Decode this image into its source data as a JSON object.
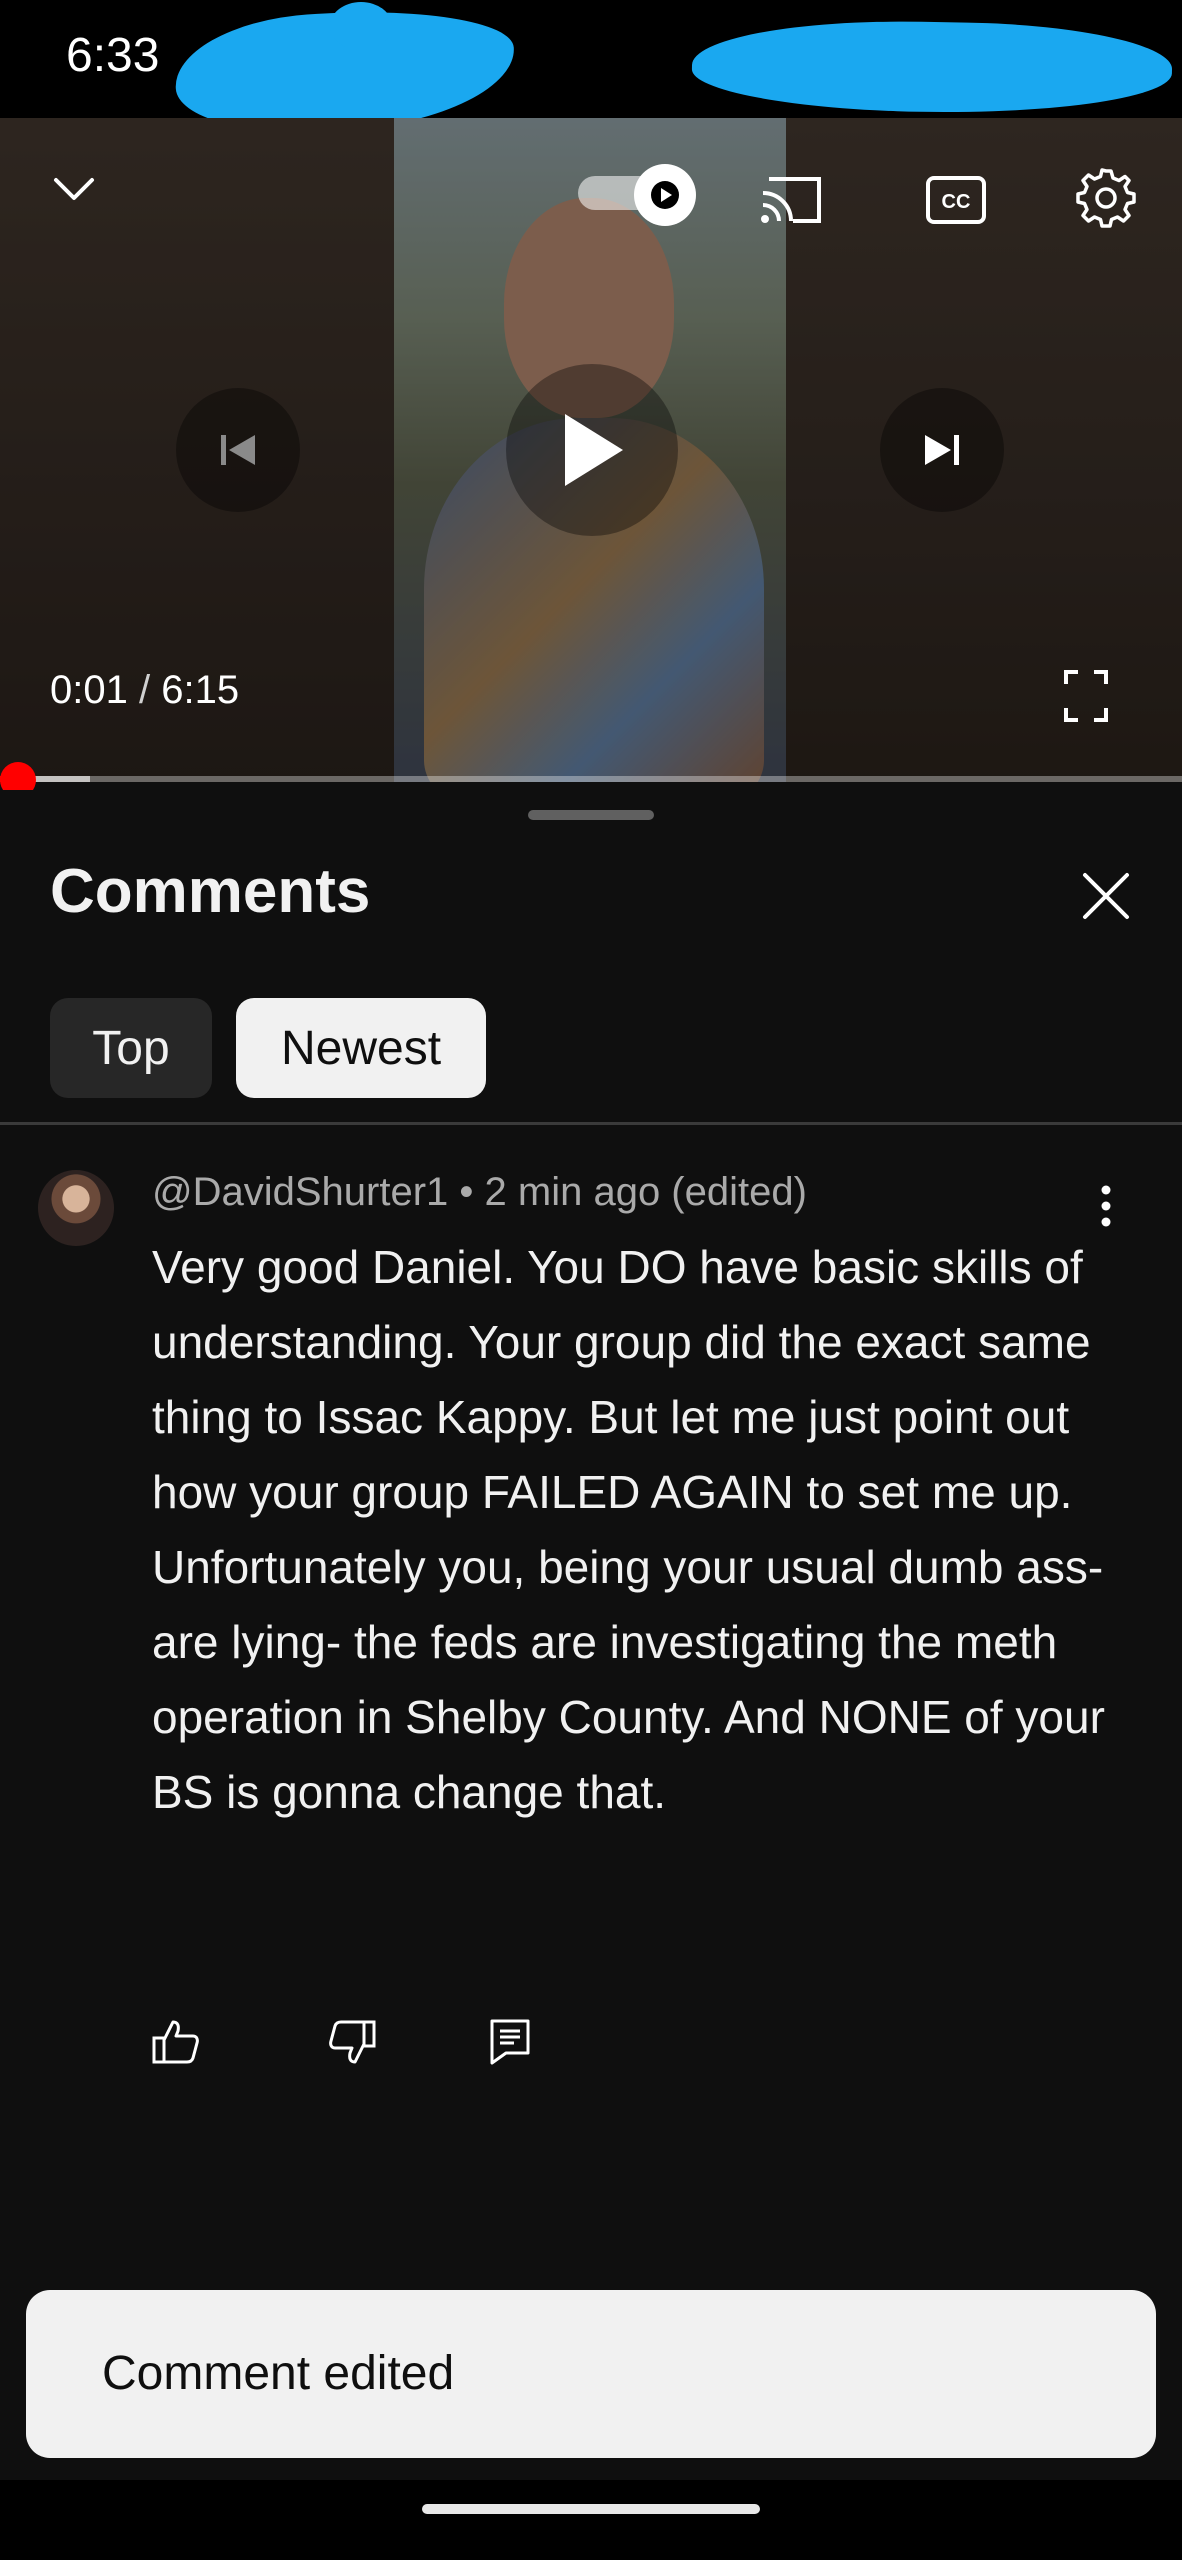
{
  "status_bar": {
    "time": "6:33"
  },
  "player": {
    "current_time": "0:01",
    "separator": "/",
    "duration": "6:15",
    "progress_fraction": 0.003,
    "icons": {
      "collapse": "chevron-down-icon",
      "autoplay": "autoplay-toggle-icon",
      "cast": "cast-icon",
      "captions": "cc-icon",
      "settings": "gear-icon",
      "previous": "skip-previous-icon",
      "play": "play-icon",
      "next": "skip-next-icon",
      "fullscreen": "fullscreen-icon"
    },
    "accent_color": "#ff0000"
  },
  "comments_sheet": {
    "title": "Comments",
    "filters": [
      {
        "label": "Top",
        "selected": false
      },
      {
        "label": "Newest",
        "selected": true
      }
    ],
    "comments": [
      {
        "author": "@DavidShurter1",
        "meta": " • 2 min ago (edited)",
        "text": "Very good Daniel. You DO have basic skills of understanding. Your group did the exact same thing to Issac Kappy. But let me just point out how your group FAILED AGAIN to set me up. Unfortunately you, being your usual dumb ass- are lying- the feds are investigating the meth operation in Shelby County. And NONE of your BS is gonna change that."
      }
    ]
  },
  "toast": {
    "message": "Comment edited"
  }
}
